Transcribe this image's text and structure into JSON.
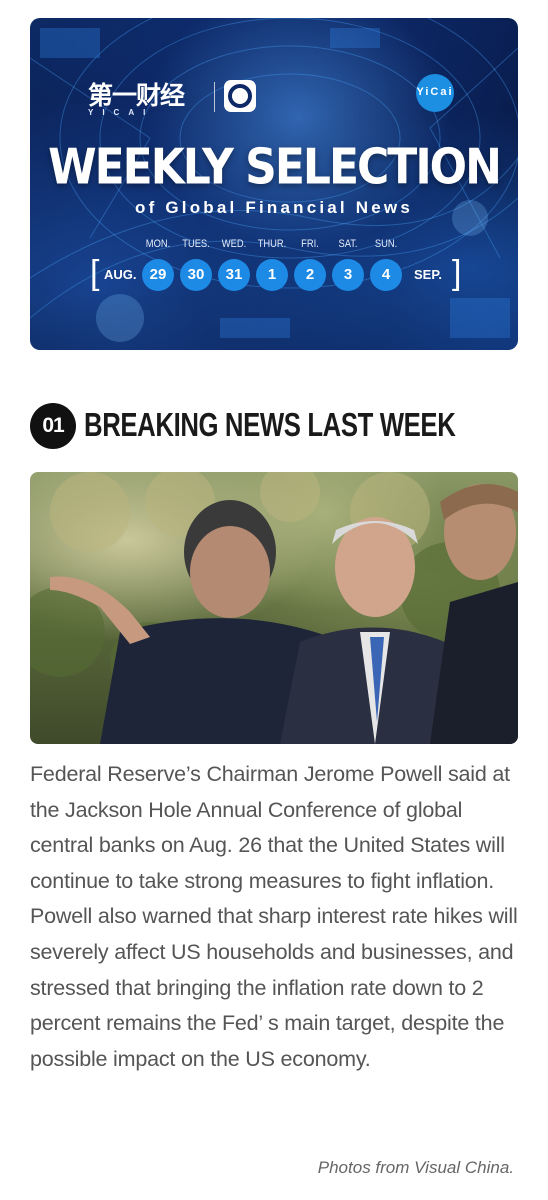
{
  "banner": {
    "logo_cn": "第一财经",
    "logo_sub": "YICAI",
    "badge_text": "YiCai",
    "badge_icon": "yicai-global-logo-icon",
    "app_icon": "yicai-app-icon",
    "title": "WEEKLY SELECTION",
    "subtitle": "of Global Financial News",
    "days": [
      "MON.",
      "TUES.",
      "WED.",
      "THUR.",
      "FRI.",
      "SAT.",
      "SUN."
    ],
    "dates": [
      "29",
      "30",
      "31",
      "1",
      "2",
      "3",
      "4"
    ],
    "month_start": "AUG.",
    "month_end": "SEP.",
    "bracket_left": "[",
    "bracket_right": "]",
    "accent_color": "#1d8ae6"
  },
  "section": {
    "number": "01",
    "title": "BREAKING NEWS LAST WEEK"
  },
  "photo": {
    "alt_icon": "news-photo"
  },
  "article": {
    "body": "Federal Reserve’s Chairman Jerome Powell said at the Jackson Hole Annual Conference of global central banks on Aug. 26 that the United States will continue to take strong measures to fight inflation. Powell also warned that sharp interest rate hikes will severely affect US households and businesses, and stressed that bringing the inflation rate down to 2 percent remains the Fed’ s main target, despite the possible impact on the US economy.",
    "credit": "Photos from Visual China."
  }
}
